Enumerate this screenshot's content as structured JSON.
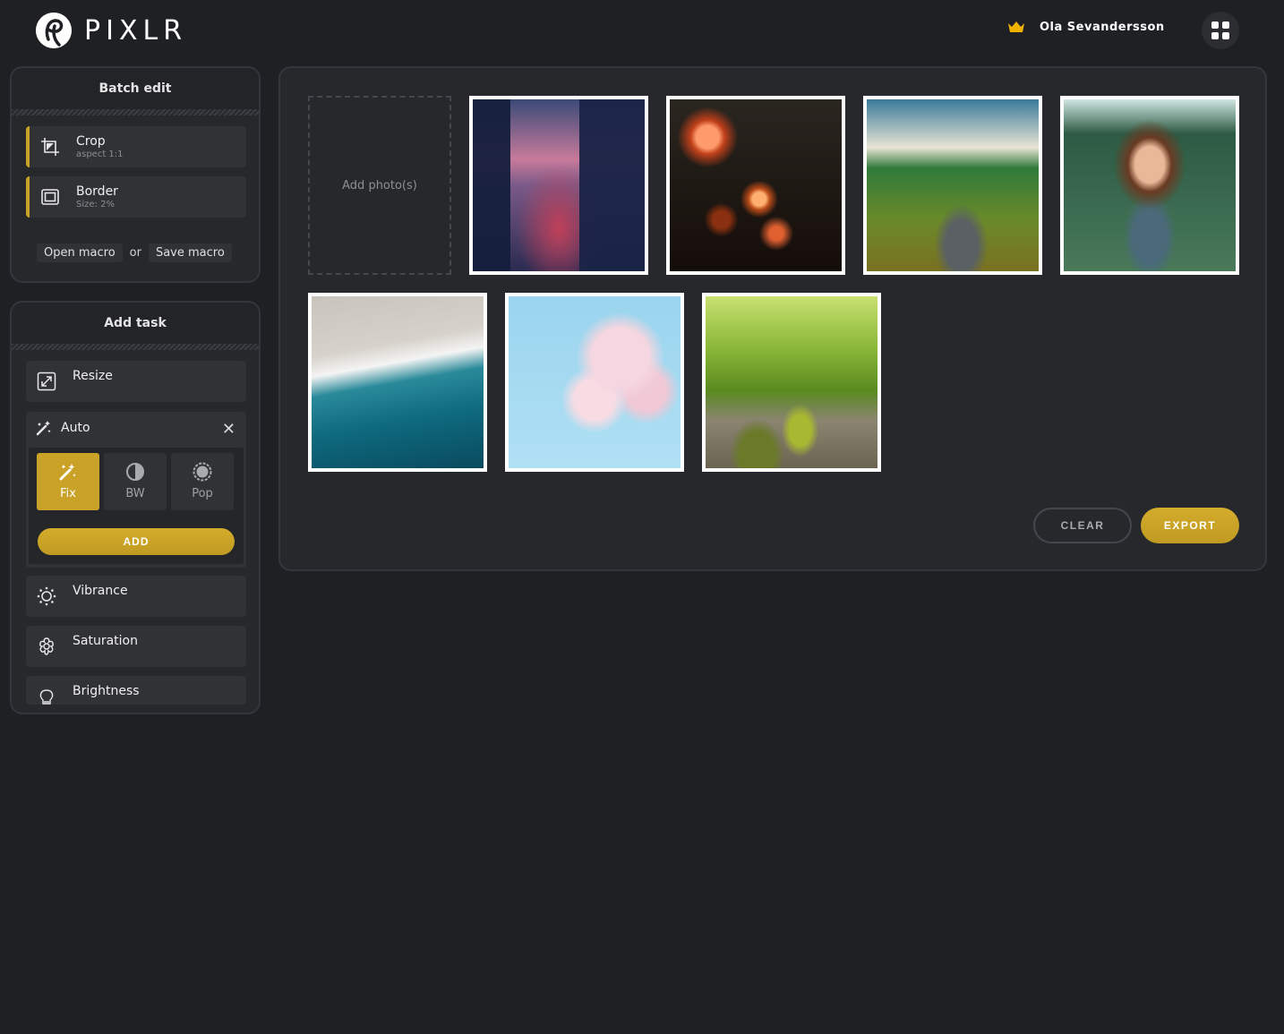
{
  "header": {
    "brand": "PIXLR",
    "user_name": "Ola Sevandersson",
    "icons": {
      "logo": "pixlr-logo-icon",
      "premium": "crown-icon",
      "apps": "grid-apps-icon"
    }
  },
  "batch_edit": {
    "title": "Batch edit",
    "tasks": [
      {
        "title": "Crop",
        "subtitle": "aspect 1:1",
        "icon": "crop-icon"
      },
      {
        "title": "Border",
        "subtitle": "Size: 2%",
        "icon": "border-icon"
      }
    ],
    "open_macro": "Open macro",
    "or_label": "or",
    "save_macro": "Save macro"
  },
  "add_task": {
    "title": "Add task",
    "items": [
      {
        "title": "Resize",
        "icon": "resize-icon"
      },
      {
        "title": "Vibrance",
        "icon": "sun-icon"
      },
      {
        "title": "Saturation",
        "icon": "flower-icon"
      },
      {
        "title": "Brightness",
        "icon": "bulb-icon"
      }
    ],
    "auto": {
      "title": "Auto",
      "options": [
        {
          "label": "Fix",
          "icon": "magic-wand-icon",
          "selected": true
        },
        {
          "label": "BW",
          "icon": "contrast-icon",
          "selected": false
        },
        {
          "label": "Pop",
          "icon": "pop-icon",
          "selected": false
        }
      ],
      "add_label": "ADD"
    }
  },
  "main": {
    "add_photos_label": "Add photo(s)",
    "photos": [
      {
        "subject": "city-river-dusk"
      },
      {
        "subject": "string-lights-bulbs"
      },
      {
        "subject": "green-valley"
      },
      {
        "subject": "smiling-girl-in-greenery"
      },
      {
        "subject": "ocean-wave-aerial"
      },
      {
        "subject": "cherry-blossom"
      },
      {
        "subject": "forest-stream"
      }
    ],
    "clear_label": "CLEAR",
    "export_label": "EXPORT"
  },
  "colors": {
    "accent": "#c9a227",
    "background": "#1e2024",
    "panel": "#26282c"
  }
}
